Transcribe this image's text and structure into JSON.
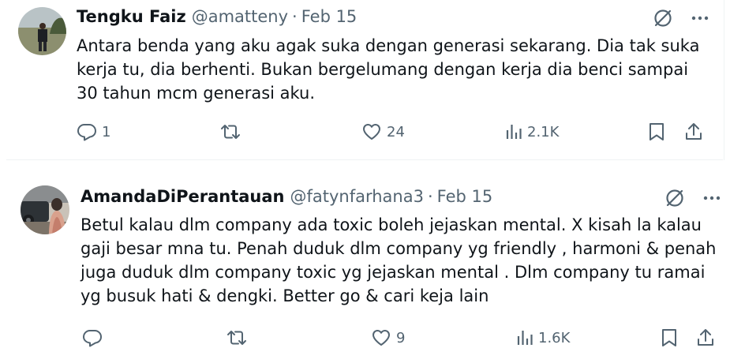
{
  "tweets": [
    {
      "name": "Tengku Faiz",
      "handle": "@amatteny",
      "separator": "·",
      "date": "Feb 15",
      "text": "Antara benda yang aku agak suka dengan generasi sekarang. Dia tak suka\nkerja tu, dia berhenti. Bukan bergelumang dengan kerja dia benci sampai\n30 tahun mcm generasi aku.",
      "replies": "1",
      "retweets": "",
      "likes": "24",
      "views": "2.1K",
      "icons": [
        "grok-icon",
        "more-icon",
        "reply-icon",
        "retweet-icon",
        "like-icon",
        "views-icon",
        "bookmark-icon",
        "share-icon"
      ]
    },
    {
      "name": "AmandaDiPerantauan",
      "handle": "@fatynfarhana3",
      "separator": "·",
      "date": "Feb 15",
      "text": "Betul kalau dlm company ada toxic boleh jejaskan mental. X kisah la kalau\ngaji besar mna tu. Penah duduk dlm company yg friendly , harmoni & penah\njuga duduk dlm company toxic yg jejaskan mental . Dlm company tu ramai\nyg busuk hati & dengki. Better go & cari keja lain",
      "replies": "",
      "retweets": "",
      "likes": "9",
      "views": "1.6K",
      "icons": [
        "grok-icon",
        "more-icon",
        "reply-icon",
        "retweet-icon",
        "like-icon",
        "views-icon",
        "bookmark-icon",
        "share-icon"
      ]
    }
  ],
  "colors": {
    "text": "#0f1419",
    "secondary": "#536471",
    "divider": "#eff3f4"
  }
}
